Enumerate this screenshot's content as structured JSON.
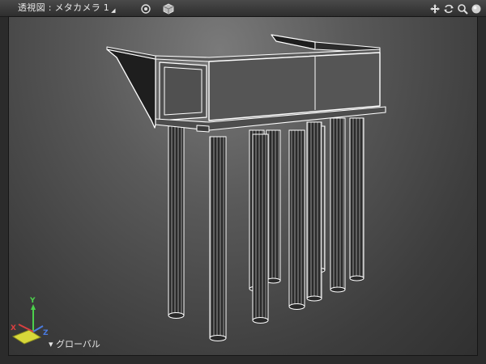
{
  "toolbar": {
    "title": "透視図 : メタカメラ 1",
    "caret": "◢",
    "icons": [
      "target-icon",
      "cube-icon",
      "move-icon",
      "rotate-icon",
      "zoom-icon",
      "sphere-icon"
    ]
  },
  "viewport": {
    "coordinate_mode": "グローバル",
    "coordinate_caret": "▾",
    "axes": {
      "x": "X",
      "y": "Y",
      "z": "Z"
    }
  },
  "colors": {
    "axis_x": "#d84040",
    "axis_y": "#4cd04c",
    "axis_z": "#4a7be0",
    "wire": "#ffffff",
    "solid": "#222222"
  }
}
